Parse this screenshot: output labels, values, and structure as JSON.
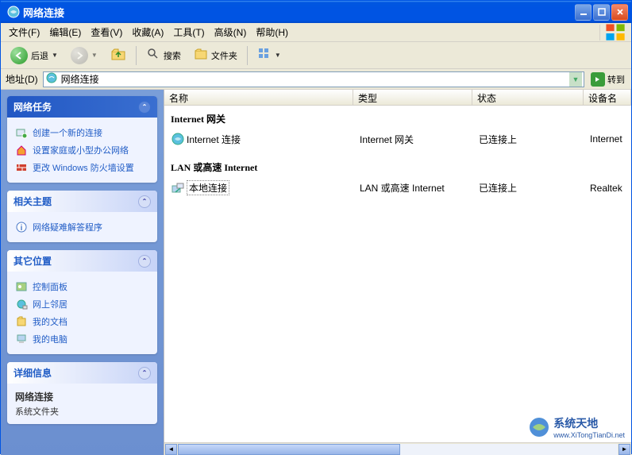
{
  "window": {
    "title": "网络连接"
  },
  "menu": {
    "file": "文件(F)",
    "edit": "编辑(E)",
    "view": "查看(V)",
    "favorites": "收藏(A)",
    "tools": "工具(T)",
    "advanced": "高级(N)",
    "help": "帮助(H)"
  },
  "toolbar": {
    "back": "后退",
    "search": "搜索",
    "folders": "文件夹"
  },
  "addressbar": {
    "label": "地址(D)",
    "value": "网络连接",
    "go": "转到"
  },
  "sidebar": {
    "tasks": {
      "title": "网络任务",
      "items": [
        {
          "icon": "new-connection",
          "label": "创建一个新的连接"
        },
        {
          "icon": "home-network",
          "label": "设置家庭或小型办公网络"
        },
        {
          "icon": "firewall",
          "label": "更改 Windows 防火墙设置"
        }
      ]
    },
    "related": {
      "title": "相关主题",
      "items": [
        {
          "icon": "help",
          "label": "网络疑难解答程序"
        }
      ]
    },
    "other": {
      "title": "其它位置",
      "items": [
        {
          "icon": "control-panel",
          "label": "控制面板"
        },
        {
          "icon": "network-places",
          "label": "网上邻居"
        },
        {
          "icon": "my-documents",
          "label": "我的文档"
        },
        {
          "icon": "my-computer",
          "label": "我的电脑"
        }
      ]
    },
    "details": {
      "title": "详细信息",
      "name": "网络连接",
      "type": "系统文件夹"
    }
  },
  "list": {
    "columns": {
      "name": "名称",
      "type": "类型",
      "status": "状态",
      "device": "设备名"
    },
    "groups": [
      {
        "header": "Internet 网关",
        "items": [
          {
            "name": "Internet 连接",
            "type": "Internet 网关",
            "status": "已连接上",
            "device": "Internet"
          }
        ]
      },
      {
        "header": "LAN 或高速 Internet",
        "items": [
          {
            "name": "本地连接",
            "type": "LAN 或高速 Internet",
            "status": "已连接上",
            "device": "Realtek",
            "selected": true
          }
        ]
      }
    ]
  },
  "watermark": {
    "brand": "系统天地",
    "url": "www.XiTongTianDi.net"
  }
}
